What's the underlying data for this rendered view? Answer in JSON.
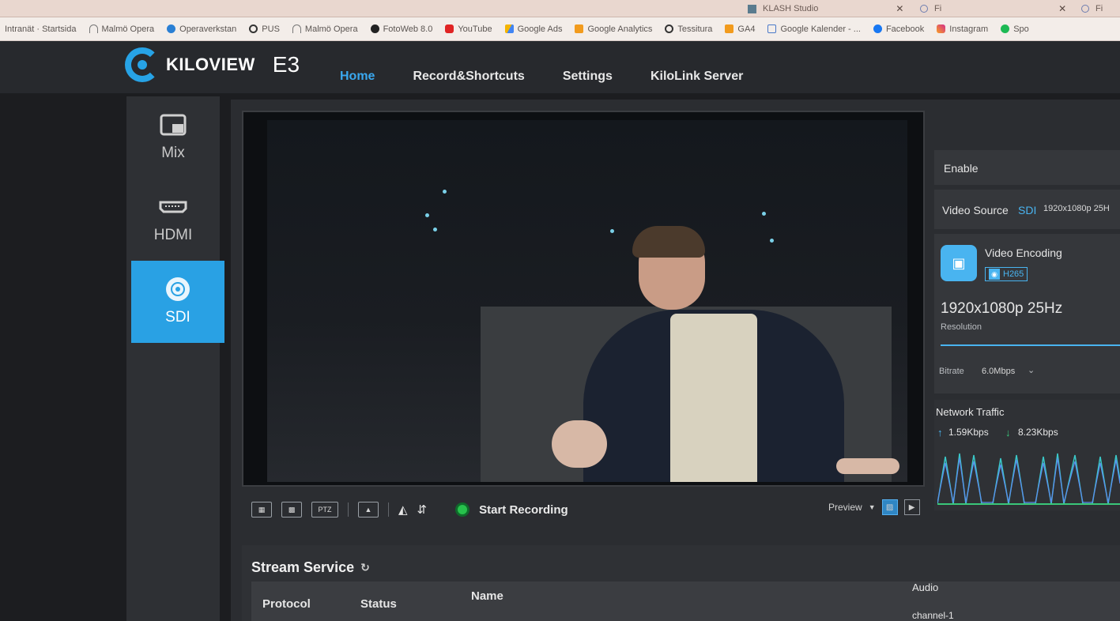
{
  "browser": {
    "tabs": [
      {
        "label": "KLASH Studio"
      },
      {
        "label": "Fi"
      },
      {
        "label": "Fi"
      }
    ],
    "bookmarks": [
      {
        "label": "Intranät · Startsida",
        "icon": "doc-icon"
      },
      {
        "label": "Malmö Opera",
        "icon": "arch-icon"
      },
      {
        "label": "Operaverkstan",
        "icon": "cloud-icon"
      },
      {
        "label": "PUS",
        "icon": "globe-icon"
      },
      {
        "label": "Malmö Opera",
        "icon": "arch-icon"
      },
      {
        "label": "FotoWeb 8.0",
        "icon": "globe-icon"
      },
      {
        "label": "YouTube",
        "icon": "youtube-icon"
      },
      {
        "label": "Google Ads",
        "icon": "ads-icon"
      },
      {
        "label": "Google Analytics",
        "icon": "analytics-icon"
      },
      {
        "label": "Tessitura",
        "icon": "globe-icon"
      },
      {
        "label": "GA4",
        "icon": "analytics-icon"
      },
      {
        "label": "Google Kalender - ...",
        "icon": "calendar-icon"
      },
      {
        "label": "Facebook",
        "icon": "facebook-icon"
      },
      {
        "label": "Instagram",
        "icon": "instagram-icon"
      },
      {
        "label": "Spo",
        "icon": "spotify-icon"
      }
    ]
  },
  "app": {
    "brand": "KILOVIEW",
    "model": "E3",
    "nav": [
      {
        "label": "Home",
        "active": true
      },
      {
        "label": "Record&Shortcuts",
        "active": false
      },
      {
        "label": "Settings",
        "active": false
      },
      {
        "label": "KiloLink Server",
        "active": false
      }
    ],
    "accent": "#29a1e4"
  },
  "sources": [
    {
      "label": "Mix",
      "icon": "mix-icon",
      "active": false
    },
    {
      "label": "HDMI",
      "icon": "hdmi-port-icon",
      "active": false
    },
    {
      "label": "SDI",
      "icon": "sdi-connector-icon",
      "active": true
    }
  ],
  "video_toolbar": {
    "ptz": "PTZ",
    "start_recording": "Start Recording",
    "preview": "Preview"
  },
  "info": {
    "enable": "Enable",
    "video_source_label": "Video Source",
    "video_source_value": "SDI",
    "video_source_format": "1920x1080p 25H",
    "encoding_title": "Video Encoding",
    "codec": "H265",
    "resolution_value": "1920x1080p 25Hz",
    "resolution_label": "Resolution",
    "bitrate_label": "Bitrate",
    "bitrate_value": "6.0Mbps",
    "network_title": "Network Traffic",
    "upload": "1.59Kbps",
    "download": "8.23Kbps"
  },
  "stream": {
    "title": "Stream Service",
    "columns": [
      "Protocol",
      "Status",
      "Name",
      "Audio"
    ],
    "audio_first": "channel-1"
  }
}
